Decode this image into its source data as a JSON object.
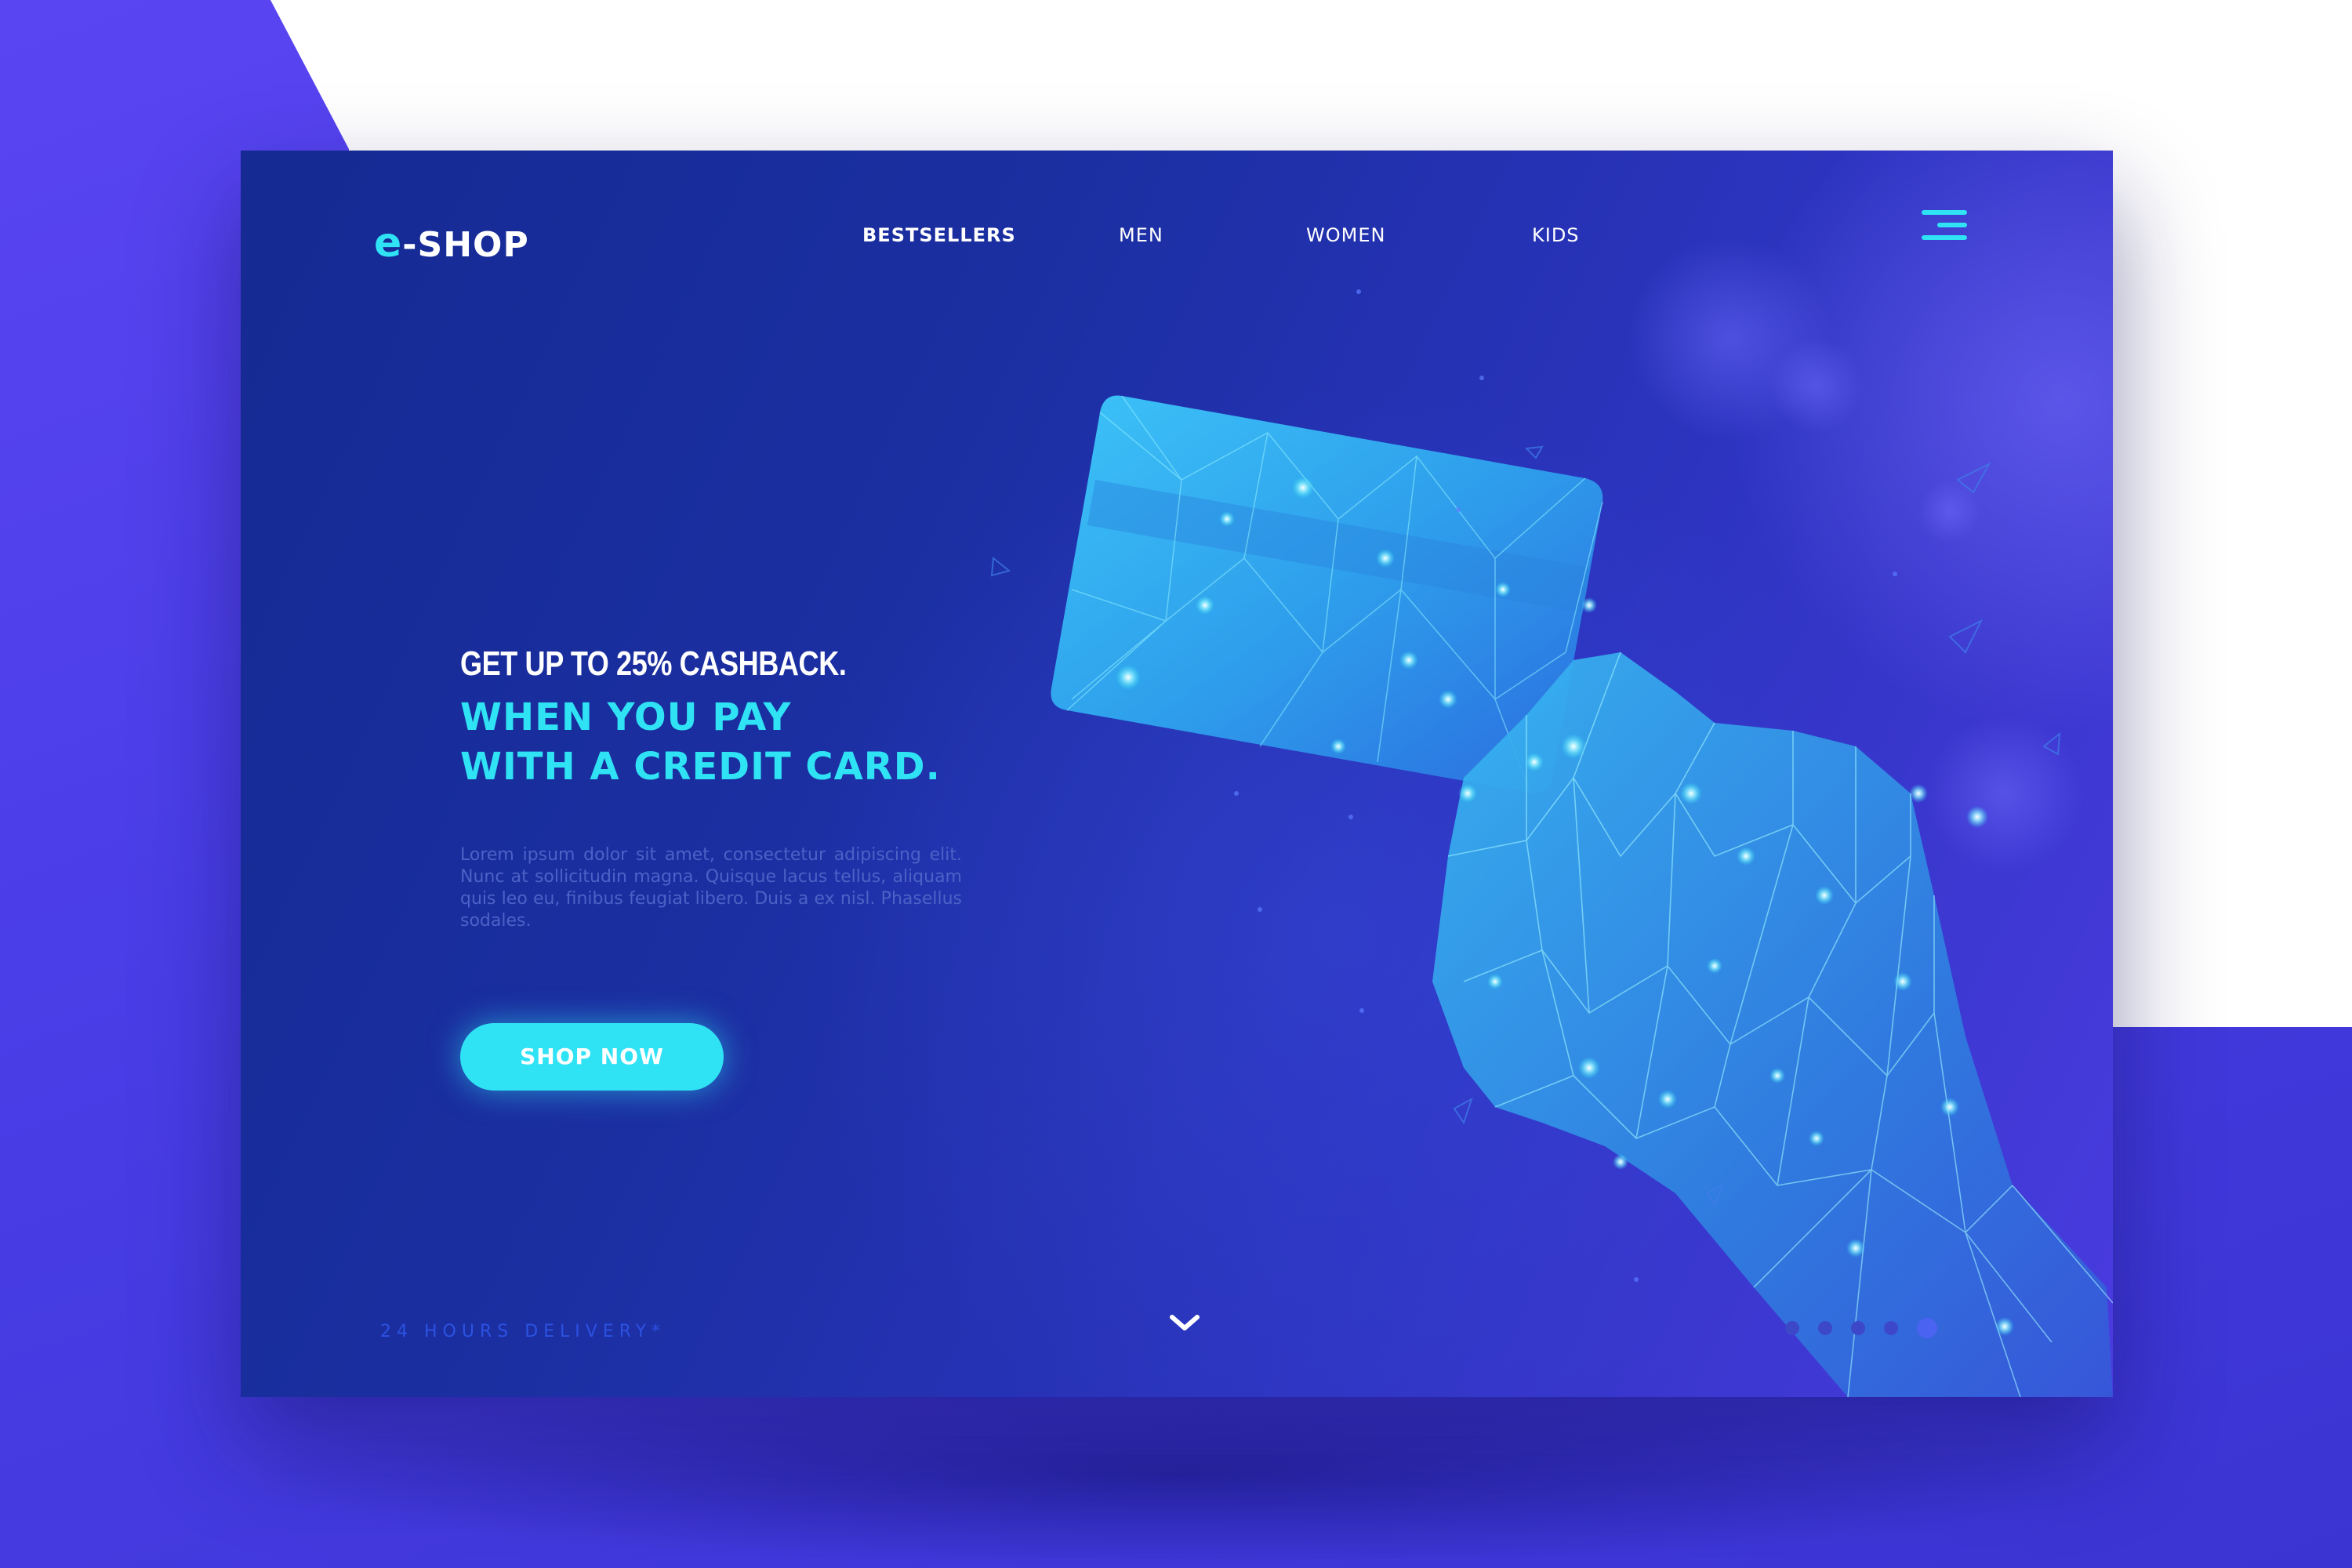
{
  "brand": {
    "logo_prefix": "e",
    "logo_suffix": "-SHOP"
  },
  "nav": {
    "items": [
      {
        "label": "BESTSELLERS",
        "active": true
      },
      {
        "label": "MEN",
        "active": false
      },
      {
        "label": "WOMEN",
        "active": false
      },
      {
        "label": "KIDS",
        "active": false
      }
    ],
    "menu_icon": "hamburger-menu-icon"
  },
  "hero": {
    "line1": "GET UP TO 25% CASHBACK.",
    "line2": "WHEN YOU PAY",
    "line3": "WITH A CREDIT CARD.",
    "body": "Lorem ipsum dolor sit amet, consectetur adipiscing elit. Nunc at sollicitudin magna. Quisque lacus tellus, aliquam quis leo eu, finibus feugiat libero. Duis a ex nisl. Phasellus sodales.",
    "cta_label": "SHOP NOW"
  },
  "footer": {
    "delivery": "24 HOURS DELIVERY*",
    "scroll_icon": "chevron-down-icon",
    "pager": {
      "count": 6,
      "active": 5
    }
  },
  "illustration": {
    "subject": "low-poly hand holding credit card",
    "icon": "credit-card-illustration"
  },
  "colors": {
    "accent": "#2fe3f5",
    "panel_dark": "#152a92",
    "panel_light": "#4a3be0",
    "background": "#4a3ee8",
    "body_text": "#4c62c6"
  }
}
